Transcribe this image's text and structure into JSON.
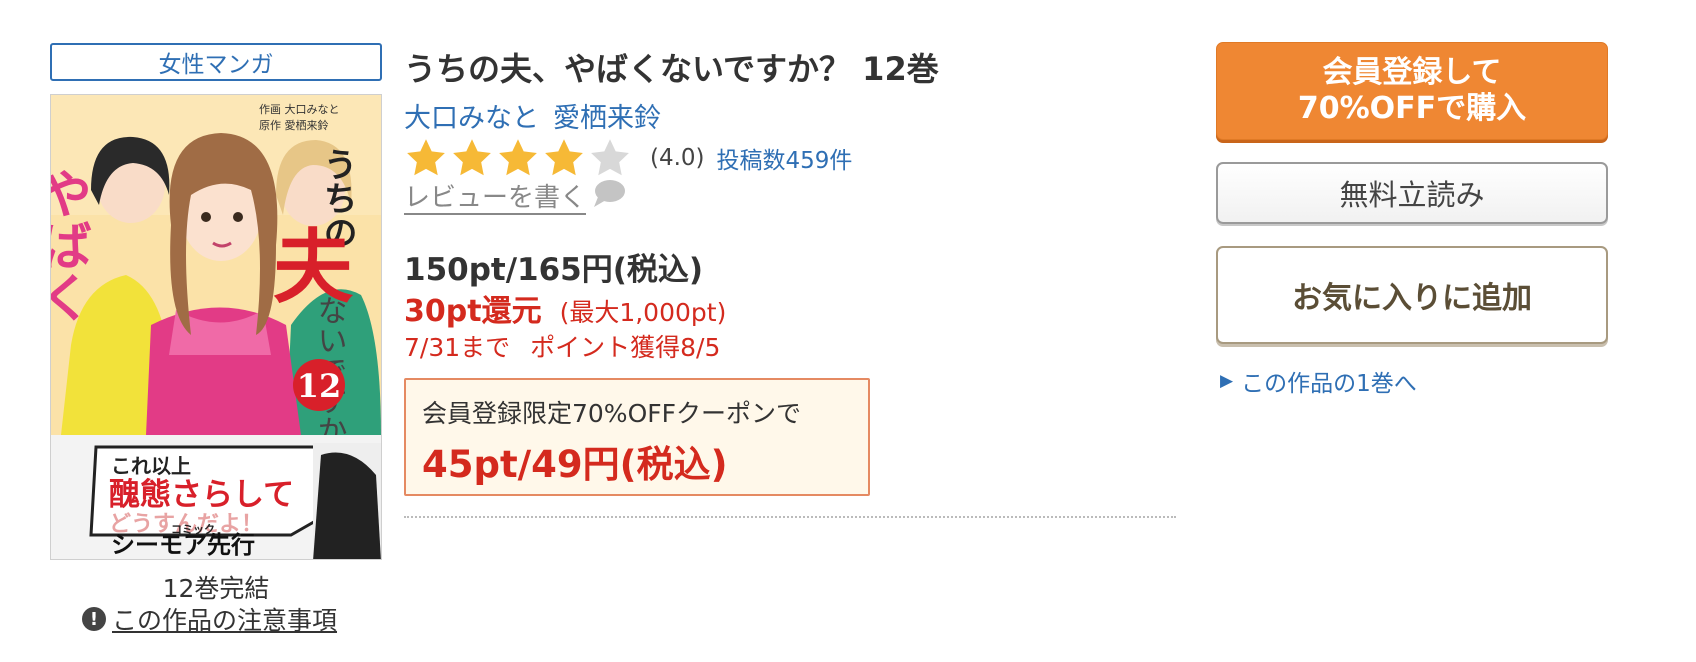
{
  "book": {
    "category": "女性マンガ",
    "title": "うちの夫、やばくないですか？ 12巻",
    "authors": [
      "大口みなと",
      "愛栖来鈴"
    ],
    "rating_value": 4.0,
    "rating_text": "(4.0)",
    "review_count_text": "投稿数459件",
    "write_review": "レビューを書く",
    "volumes_status": "12巻完結",
    "notice_link": "この作品の注意事項"
  },
  "cover": {
    "title_vertical": "うちの",
    "title_big": "夫",
    "title_pink": "やばく",
    "title_rest": "ないですか？",
    "volume_number": "12",
    "credit_line1": "作画 大口みなと",
    "credit_line2": "原作 愛栖来鈴",
    "banner_line1": "これ以上",
    "banner_line2": "醜態さらして",
    "banner_line3": "どうすんだよ！",
    "label_small": "コミック",
    "label": "シーモア先行"
  },
  "pricing": {
    "price": "150pt/165円(税込)",
    "reward": "30pt還元",
    "reward_max": "(最大1,000pt)",
    "deadline": "7/31まで",
    "points_date": "ポイント獲得8/5",
    "coupon_label": "会員登録限定70%OFFクーポンで",
    "coupon_price": "45pt/49円(税込)"
  },
  "actions": {
    "buy_line1": "会員登録して",
    "buy_line2": "70%OFFで購入",
    "free_read": "無料立読み",
    "add_favorite": "お気に入りに追加",
    "first_volume_link": "この作品の1巻へ"
  },
  "colors": {
    "accent_blue": "#2f6fb4",
    "price_red": "#d42a1e",
    "buy_orange": "#ef8733",
    "star_gold": "#f6b936",
    "star_gray": "#d8d8d8"
  }
}
